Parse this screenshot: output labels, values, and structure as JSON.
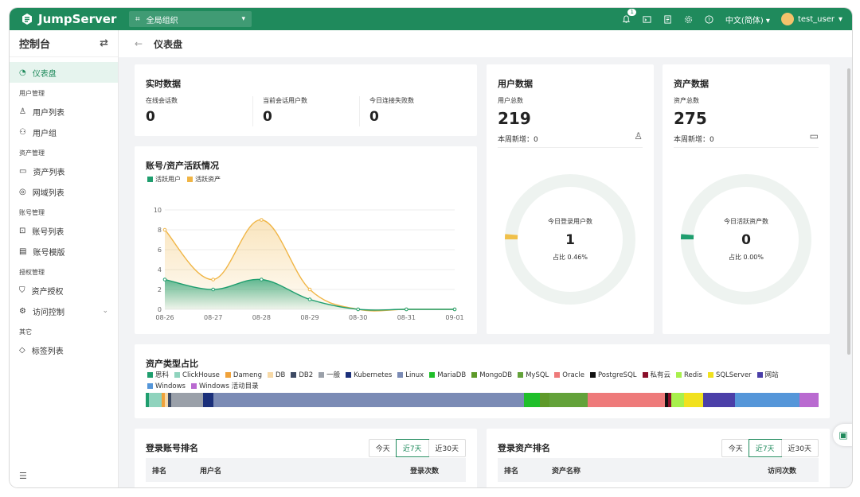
{
  "topbar": {
    "brand": "JumpServer",
    "org": "全局组织",
    "notify_count": "1",
    "language": "中文(简体)",
    "user": "test_user"
  },
  "sidebar": {
    "title": "控制台",
    "items": [
      {
        "label": "仪表盘",
        "group": ""
      },
      {
        "label": "用户列表",
        "group": "用户管理"
      },
      {
        "label": "用户组",
        "group": ""
      },
      {
        "label": "资产列表",
        "group": "资产管理"
      },
      {
        "label": "网域列表",
        "group": ""
      },
      {
        "label": "账号列表",
        "group": "账号管理"
      },
      {
        "label": "账号模版",
        "group": ""
      },
      {
        "label": "资产授权",
        "group": "授权管理"
      },
      {
        "label": "访问控制",
        "group": ""
      },
      {
        "label": "标签列表",
        "group": "其它"
      }
    ]
  },
  "page": {
    "title": "仪表盘"
  },
  "realtime": {
    "title": "实时数据",
    "stats": [
      {
        "label": "在线会话数",
        "value": "0"
      },
      {
        "label": "当前会话用户数",
        "value": "0"
      },
      {
        "label": "今日连接失败数",
        "value": "0"
      }
    ]
  },
  "users": {
    "title": "用户数据",
    "total_label": "用户总数",
    "total": "219",
    "weekly": "本周新增：0",
    "ring_label": "今日登录用户数",
    "ring_value": "1",
    "ring_ratio": "占比 0.46%",
    "ratio": 0.0046
  },
  "assets": {
    "title": "资产数据",
    "total_label": "资产总数",
    "total": "275",
    "weekly": "本周新增：0",
    "ring_label": "今日活跃资产数",
    "ring_value": "0",
    "ring_ratio": "占比 0.00%",
    "ratio": 0.0
  },
  "activity": {
    "title": "账号/资产活跃情况"
  },
  "chart_data": {
    "type": "area",
    "categories": [
      "08-26",
      "08-27",
      "08-28",
      "08-29",
      "08-30",
      "08-31",
      "09-01"
    ],
    "ylim": [
      0,
      10
    ],
    "yticks": [
      0,
      2,
      4,
      6,
      8,
      10
    ],
    "series": [
      {
        "name": "活跃用户",
        "values": [
          3,
          2,
          3,
          1,
          0,
          0,
          0
        ],
        "color": "#1f9e6e"
      },
      {
        "name": "活跃资产",
        "values": [
          8,
          3,
          9,
          2,
          0,
          0,
          0
        ],
        "color": "#f0b545"
      }
    ],
    "grid": true,
    "legend": "top-left"
  },
  "asset_types": {
    "title": "资产类型占比",
    "legend": [
      {
        "name": "思科",
        "color": "#1f9e6e",
        "value": 1
      },
      {
        "name": "ClickHouse",
        "color": "#8fd3bd",
        "value": 4
      },
      {
        "name": "Dameng",
        "color": "#f0a23a",
        "value": 1
      },
      {
        "name": "DB",
        "color": "#f7d9a6",
        "value": 1
      },
      {
        "name": "DB2",
        "color": "#3d4a63",
        "value": 1
      },
      {
        "name": "一般",
        "color": "#9aa0a9",
        "value": 10
      },
      {
        "name": "Kubernetes",
        "color": "#1a2f7a",
        "value": 3
      },
      {
        "name": "Linux",
        "color": "#7b8bb5",
        "value": 97
      },
      {
        "name": "MariaDB",
        "color": "#1fbf2a",
        "value": 5
      },
      {
        "name": "MongoDB",
        "color": "#5e9a2a",
        "value": 3
      },
      {
        "name": "MySQL",
        "color": "#63a23a",
        "value": 12
      },
      {
        "name": "Oracle",
        "color": "#ee7a7a",
        "value": 24
      },
      {
        "name": "PostgreSQL",
        "color": "#111111",
        "value": 1
      },
      {
        "name": "私有云",
        "color": "#8a0f2a",
        "value": 1
      },
      {
        "name": "Redis",
        "color": "#a8f04c",
        "value": 4
      },
      {
        "name": "SQLServer",
        "color": "#f1e11e",
        "value": 6
      },
      {
        "name": "网站",
        "color": "#4b3fa8",
        "value": 10
      },
      {
        "name": "Windows",
        "color": "#5596d9",
        "value": 20
      },
      {
        "name": "Windows 活动目录",
        "color": "#b96ad0",
        "value": 6
      }
    ]
  },
  "rank_accounts": {
    "title": "登录账号排名",
    "tabs": [
      "今天",
      "近7天",
      "近30天"
    ],
    "active_tab": 1,
    "columns": [
      "排名",
      "用户名",
      "登录次数"
    ]
  },
  "rank_assets": {
    "title": "登录资产排名",
    "tabs": [
      "今天",
      "近7天",
      "近30天"
    ],
    "active_tab": 1,
    "columns": [
      "排名",
      "资产名称",
      "访问次数"
    ]
  }
}
